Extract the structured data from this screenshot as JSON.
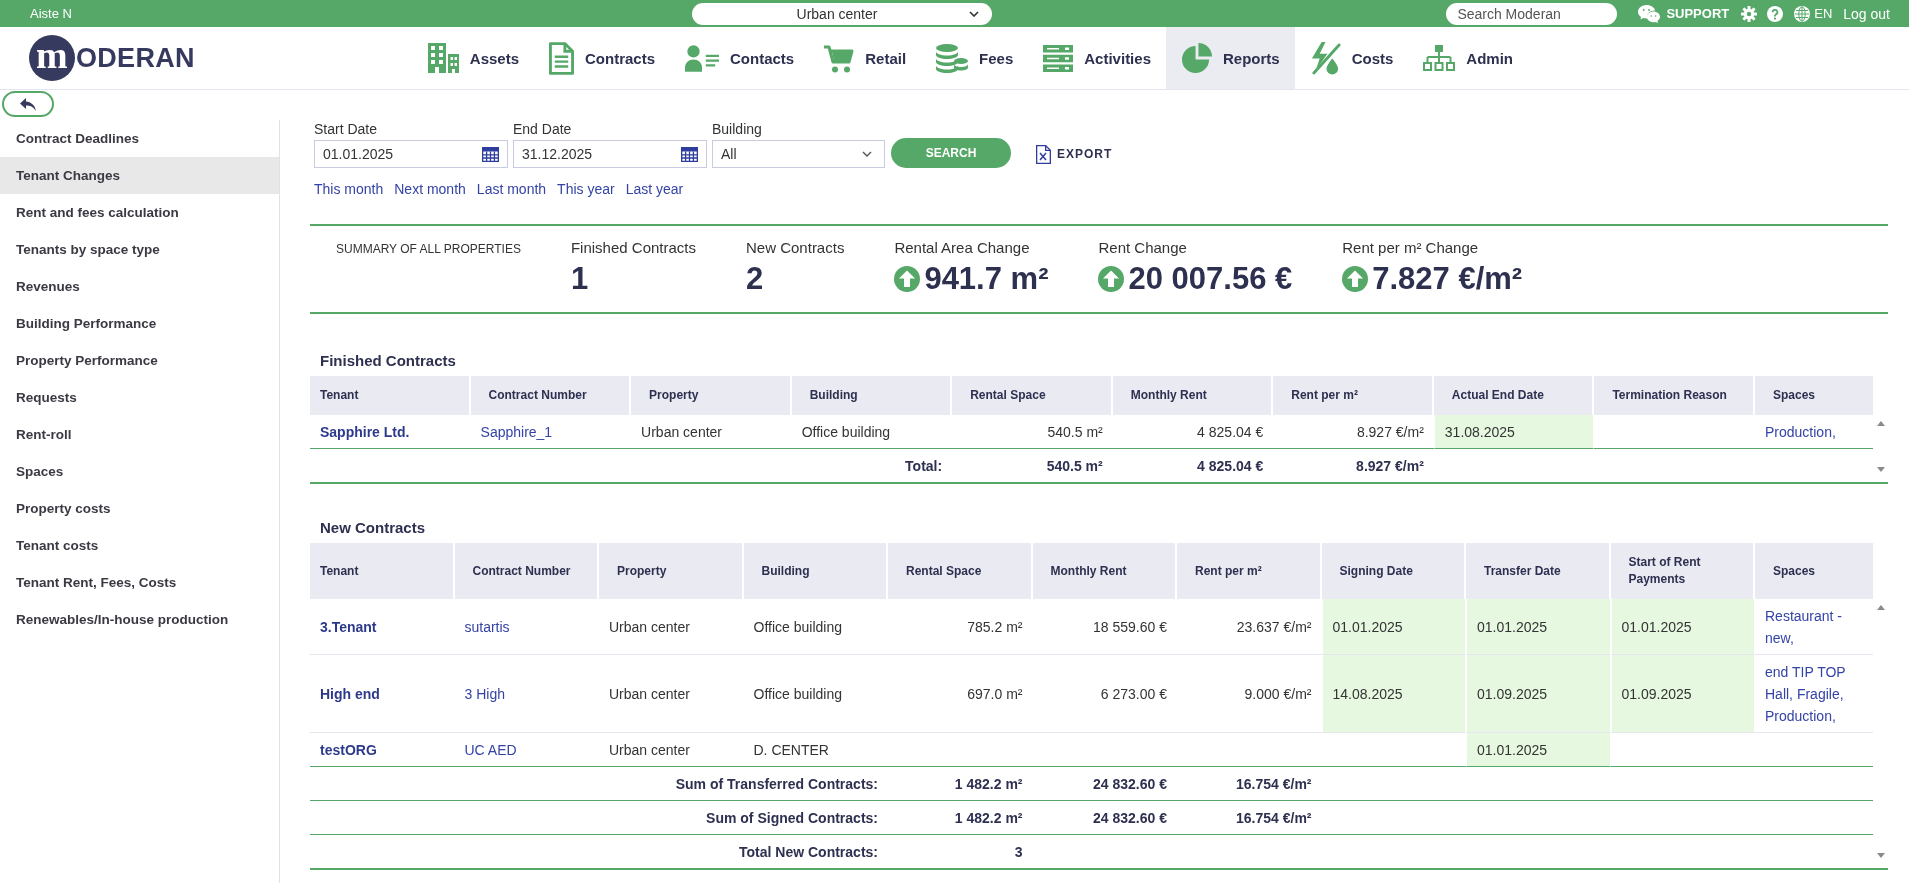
{
  "top_bar": {
    "user": "Aiste N",
    "building_select": "Urban center",
    "search": {
      "placeholder": "Search Moderan"
    },
    "support": "SUPPORT",
    "language": "EN",
    "logout": "Log out"
  },
  "logo": {
    "mark": "m",
    "text": "ODERAN"
  },
  "nav": [
    {
      "label": "Assets",
      "kind": "building",
      "selected": false
    },
    {
      "label": "Contracts",
      "kind": "document",
      "selected": false
    },
    {
      "label": "Contacts",
      "kind": "contact",
      "selected": false
    },
    {
      "label": "Retail",
      "kind": "cart",
      "selected": false
    },
    {
      "label": "Fees",
      "kind": "coins",
      "selected": false
    },
    {
      "label": "Activities",
      "kind": "server",
      "selected": false
    },
    {
      "label": "Reports",
      "kind": "pie",
      "selected": true
    },
    {
      "label": "Costs",
      "kind": "energy",
      "selected": false
    },
    {
      "label": "Admin",
      "kind": "hierarchy",
      "selected": false
    }
  ],
  "sidebar": {
    "items": [
      {
        "label": "Contract Deadlines",
        "selected": false
      },
      {
        "label": "Tenant Changes",
        "selected": true
      },
      {
        "label": "Rent and fees calculation",
        "selected": false
      },
      {
        "label": "Tenants by space type",
        "selected": false
      },
      {
        "label": "Revenues",
        "selected": false
      },
      {
        "label": "Building Performance",
        "selected": false
      },
      {
        "label": "Property Performance",
        "selected": false
      },
      {
        "label": "Requests",
        "selected": false
      },
      {
        "label": "Rent-roll",
        "selected": false
      },
      {
        "label": "Spaces",
        "selected": false
      },
      {
        "label": "Property costs",
        "selected": false
      },
      {
        "label": "Tenant costs",
        "selected": false
      },
      {
        "label": "Tenant Rent, Fees, Costs",
        "selected": false
      },
      {
        "label": "Renewables/In-house production",
        "selected": false
      }
    ]
  },
  "filters": {
    "start_date": {
      "label": "Start Date",
      "value": "01.01.2025"
    },
    "end_date": {
      "label": "End Date",
      "value": "31.12.2025"
    },
    "building": {
      "label": "Building",
      "value": "All"
    },
    "search_button": "SEARCH",
    "export_button": "EXPORT",
    "quick_links": [
      "This month",
      "Next month",
      "Last month",
      "This year",
      "Last year"
    ]
  },
  "summary": {
    "title": "SUMMARY OF ALL PROPERTIES",
    "metrics": [
      {
        "label": "Finished Contracts",
        "value": "1",
        "rising": false
      },
      {
        "label": "New Contracts",
        "value": "2",
        "rising": false
      },
      {
        "label": "Rental Area Change",
        "value": "941.7 m²",
        "rising": true
      },
      {
        "label": "Rent Change",
        "value": "20 007.56 €",
        "rising": true
      },
      {
        "label": "Rent per m² Change",
        "value": "7.827 €/m²",
        "rising": true
      }
    ]
  },
  "finished_contracts": {
    "title": "Finished Contracts",
    "columns": [
      {
        "label": "Tenant",
        "kind": "tenant"
      },
      {
        "label": "Contract Number",
        "kind": "link"
      },
      {
        "label": "Property",
        "kind": "text"
      },
      {
        "label": "Building",
        "kind": "text"
      },
      {
        "label": "Rental Space",
        "kind": "number"
      },
      {
        "label": "Monthly Rent",
        "kind": "number"
      },
      {
        "label": "Rent per m²",
        "kind": "number"
      },
      {
        "label": "Actual End Date",
        "kind": "date"
      },
      {
        "label": "Termination Reason"
      },
      {
        "label": "Spaces",
        "kind": "link"
      }
    ],
    "rows": [
      [
        "Sapphire Ltd.",
        "Sapphire_1",
        "Urban center",
        "Office building",
        "540.5 m²",
        "4 825.04 €",
        "8.927 €/m²",
        "31.08.2025",
        null,
        "Production,"
      ]
    ],
    "totals": [
      {
        "label": "Total:",
        "values": [
          "540.5 m²",
          "4 825.04 €",
          "8.927 €/m²"
        ]
      }
    ]
  },
  "new_contracts": {
    "title": "New Contracts",
    "columns": [
      {
        "label": "Tenant",
        "kind": "tenant"
      },
      {
        "label": "Contract Number",
        "kind": "link"
      },
      {
        "label": "Property",
        "kind": "text"
      },
      {
        "label": "Building",
        "kind": "text"
      },
      {
        "label": "Rental Space",
        "kind": "number"
      },
      {
        "label": "Monthly Rent",
        "kind": "number"
      },
      {
        "label": "Rent per m²",
        "kind": "number"
      },
      {
        "label": "Signing Date",
        "kind": "date"
      },
      {
        "label": "Transfer Date",
        "kind": "date"
      },
      {
        "label": "Start of Rent Payments",
        "kind": "date"
      },
      {
        "label": "Spaces",
        "kind": "link"
      }
    ],
    "rows": [
      [
        "3.Tenant",
        "sutartis",
        "Urban center",
        "Office building",
        "785.2 m²",
        "18 559.60 €",
        "23.637 €/m²",
        "01.01.2025",
        "01.01.2025",
        "01.01.2025",
        "Restaurant - new,"
      ],
      [
        "High end",
        "3 High",
        "Urban center",
        "Office building",
        "697.0 m²",
        "6 273.00 €",
        "9.000 €/m²",
        "14.08.2025",
        "01.09.2025",
        "01.09.2025",
        "end TIP TOP Hall, Fragile, Production,"
      ],
      [
        "testORG",
        "UC AED",
        "Urban center",
        "D. CENTER",
        null,
        null,
        null,
        null,
        "01.01.2025",
        null,
        null
      ]
    ],
    "totals": [
      {
        "label": "Sum of Transferred Contracts:",
        "values": [
          "1 482.2 m²",
          "24 832.60 €",
          "16.754 €/m²"
        ]
      },
      {
        "label": "Sum of Signed Contracts:",
        "values": [
          "1 482.2 m²",
          "24 832.60 €",
          "16.754 €/m²"
        ]
      },
      {
        "label": "Total New Contracts:",
        "values": [
          "3"
        ]
      }
    ]
  }
}
